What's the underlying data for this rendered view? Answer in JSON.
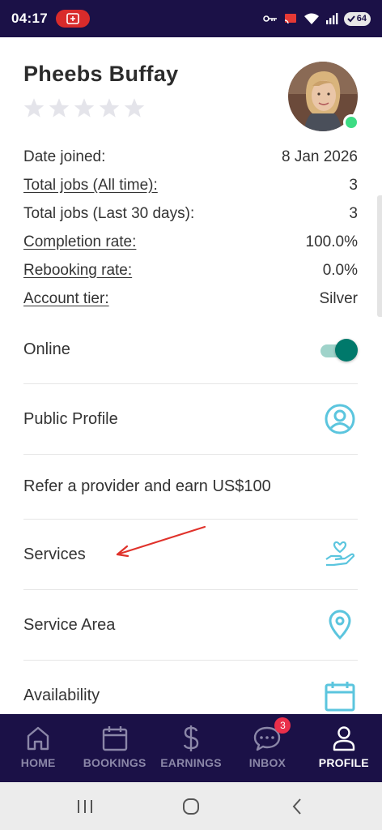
{
  "status_bar": {
    "time": "04:17",
    "battery_level": "64"
  },
  "profile": {
    "name": "Pheebs Buffay",
    "rating_stars": 0,
    "rating_max": 5,
    "online_indicator_color": "#3ddc84"
  },
  "stats": [
    {
      "label": "Date joined:",
      "value": "8 Jan 2026",
      "link": false
    },
    {
      "label": "Total jobs (All time):",
      "value": "3",
      "link": true
    },
    {
      "label": "Total jobs (Last 30 days):",
      "value": "3",
      "link": false
    },
    {
      "label": "Completion rate:",
      "value": "100.0%",
      "link": true
    },
    {
      "label": "Rebooking rate:",
      "value": "0.0%",
      "link": true
    },
    {
      "label": "Account tier:",
      "value": "Silver",
      "link": true
    }
  ],
  "menu": {
    "online": {
      "label": "Online",
      "toggle_on": true
    },
    "public_profile": {
      "label": "Public Profile",
      "icon": "user-circle-icon"
    },
    "refer": {
      "label": "Refer a provider and earn US$100"
    },
    "services": {
      "label": "Services",
      "icon": "hand-heart-icon"
    },
    "service_area": {
      "label": "Service Area",
      "icon": "map-pin-icon"
    },
    "availability": {
      "label": "Availability",
      "icon": "calendar-icon"
    }
  },
  "bottom_nav": {
    "home": "HOME",
    "bookings": "BOOKINGS",
    "earnings": "EARNINGS",
    "inbox": "INBOX",
    "inbox_badge": "3",
    "profile": "PROFILE",
    "active": "profile"
  },
  "colors": {
    "nav_background": "#1b1147",
    "icon_accent": "#5bc5de",
    "toggle_on": "#00796b",
    "badge": "#ea2f4a",
    "annotation_arrow": "#e0322b"
  }
}
